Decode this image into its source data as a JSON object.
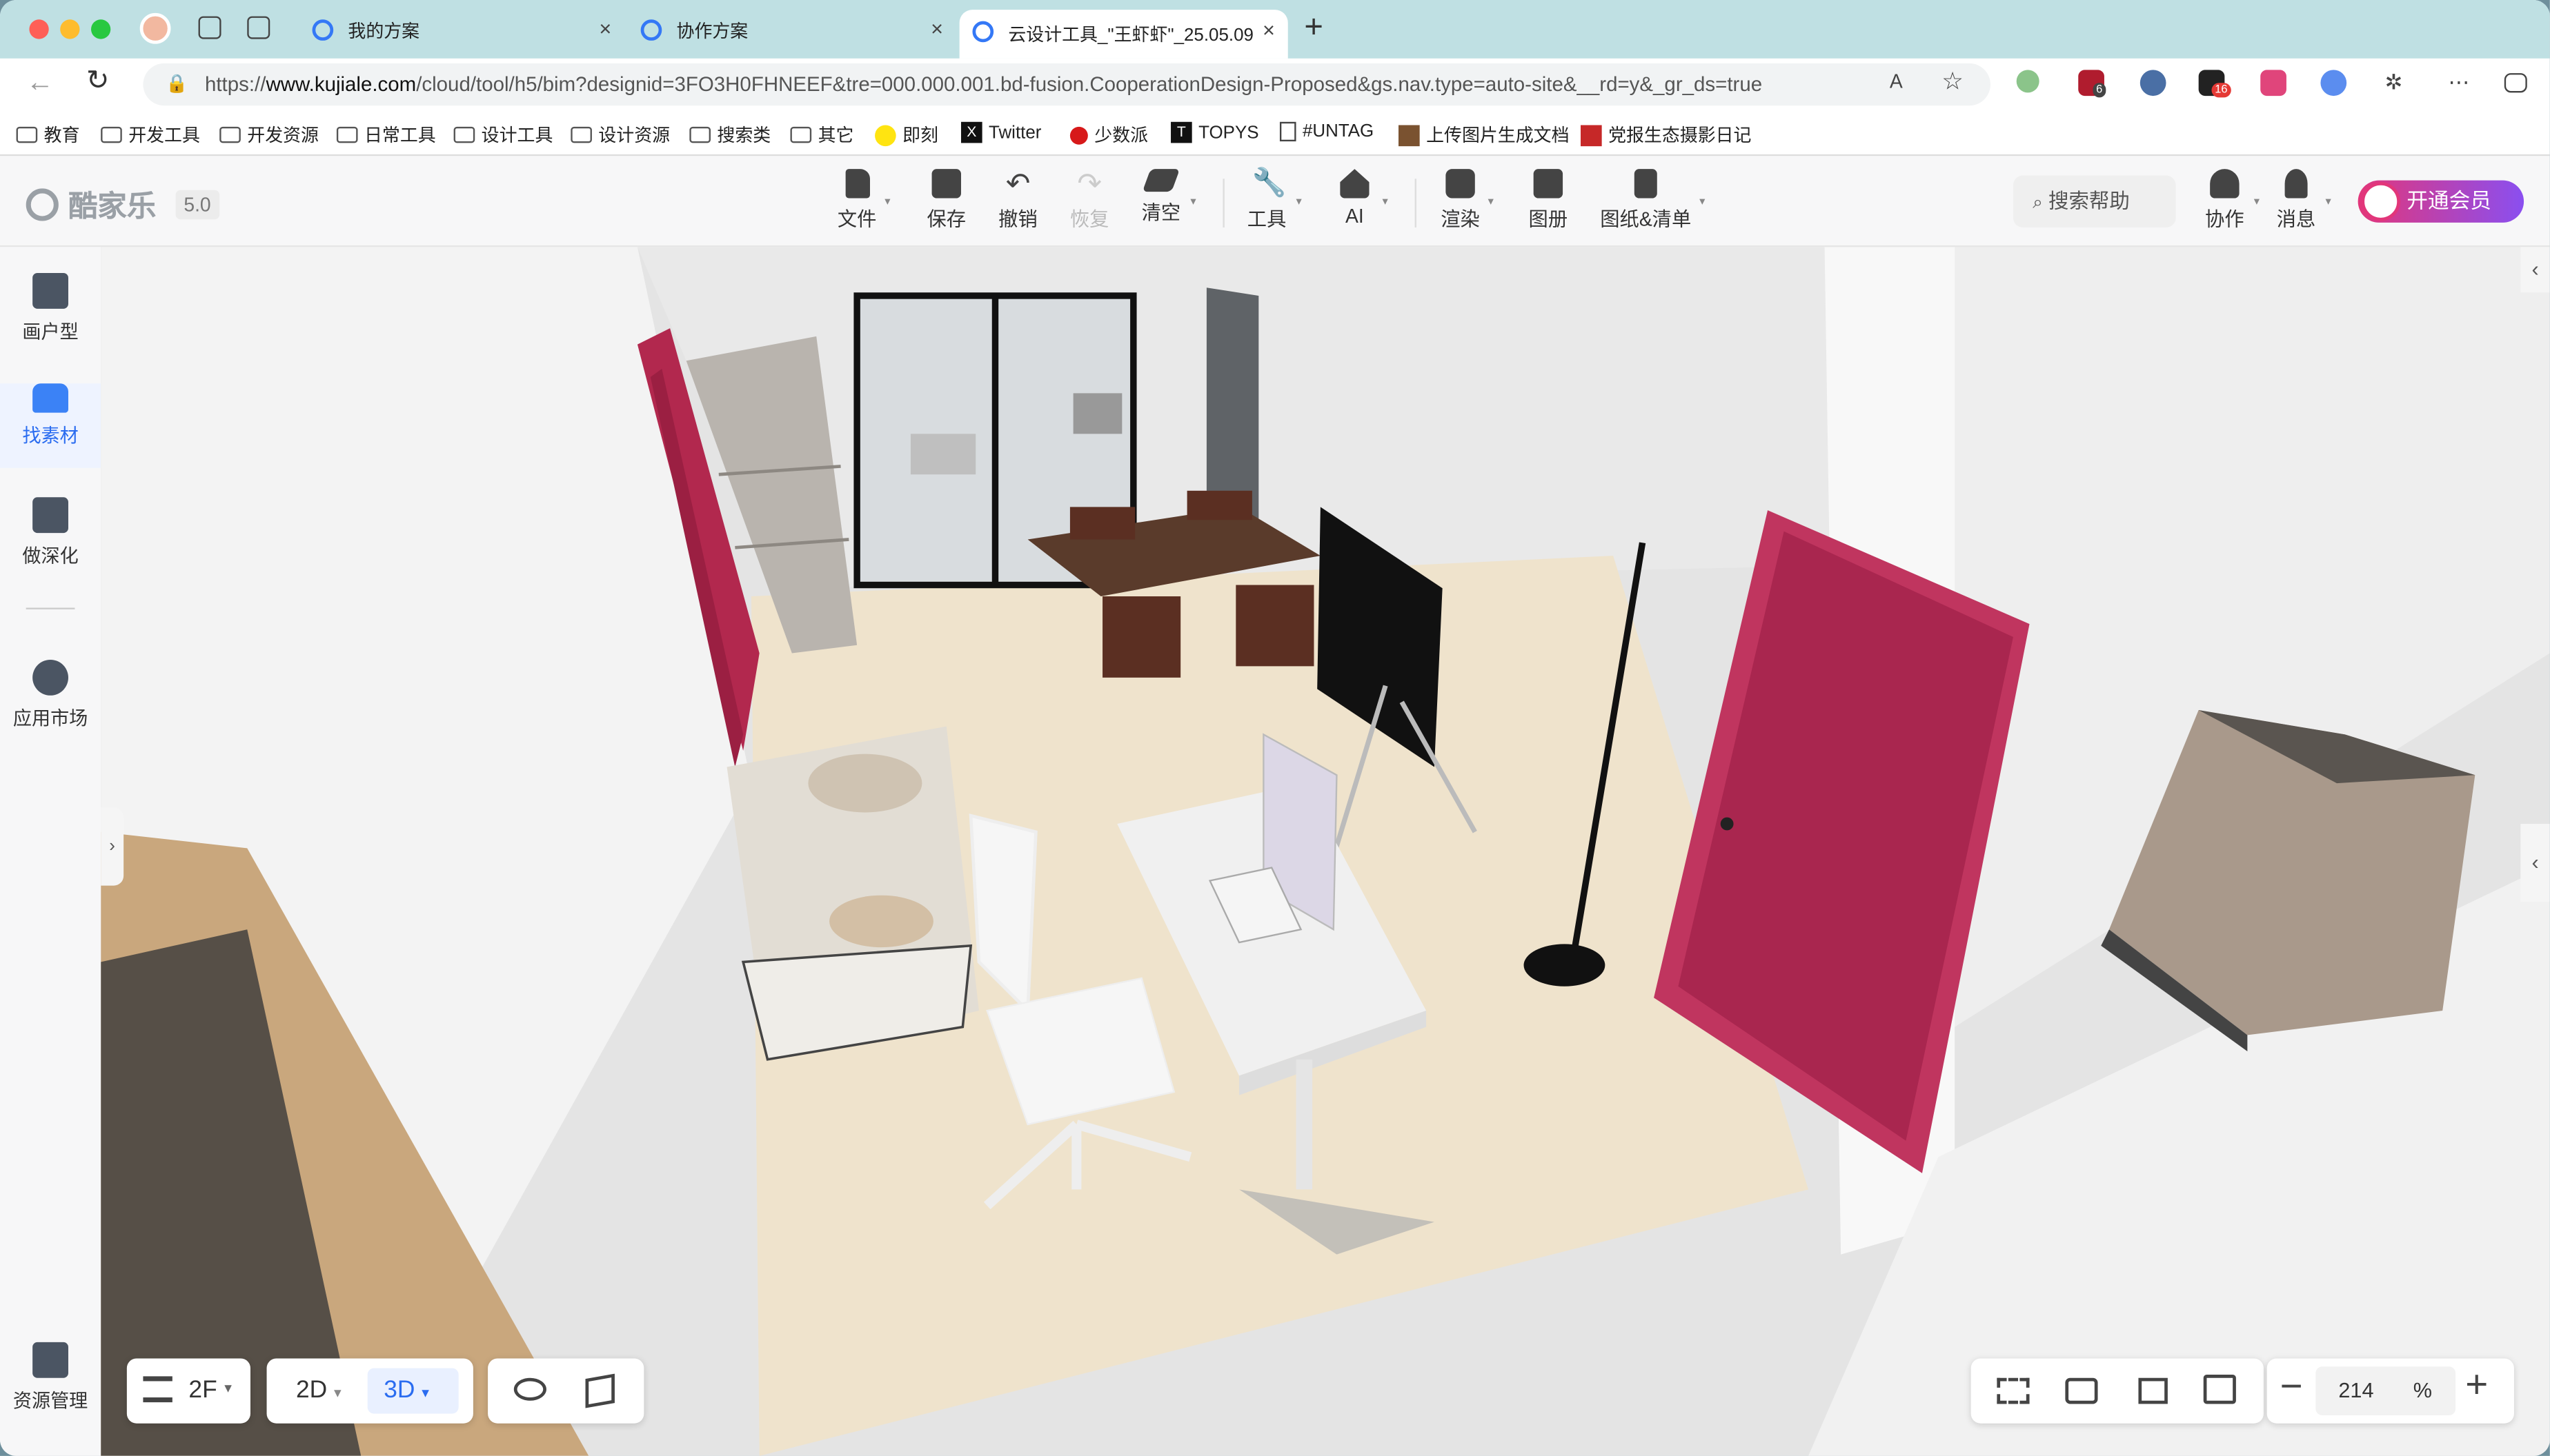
{
  "browser": {
    "tabs": [
      {
        "title": "我的方案"
      },
      {
        "title": "协作方案"
      },
      {
        "title": "云设计工具_\"王虾虾\"_25.05.09"
      }
    ],
    "url_prefix": "https://",
    "url_host": "www.kujiale.com",
    "url_path": "/cloud/tool/h5/bim?designid=3FO3H0FHNEEF&tre=000.000.001.bd-fusion.CooperationDesign-Proposed&gs.nav.type=auto-site&__rd=y&_gr_ds=true",
    "ext_badges": [
      "6",
      "16"
    ],
    "bookmarks": [
      "教育",
      "开发工具",
      "开发资源",
      "日常工具",
      "设计工具",
      "设计资源",
      "搜索类",
      "其它",
      "即刻",
      "Twitter",
      "少数派",
      "TOPYS",
      "#UNTAG",
      "上传图片生成文档",
      "党报生态摄影日记"
    ]
  },
  "app": {
    "logo": "酷家乐",
    "version": "5.0",
    "tools": [
      {
        "label": "文件",
        "icon": "file-icon"
      },
      {
        "label": "保存",
        "icon": "save-icon"
      },
      {
        "label": "撤销",
        "icon": "undo-icon"
      },
      {
        "label": "恢复",
        "icon": "redo-icon"
      },
      {
        "label": "清空",
        "icon": "eraser-icon"
      },
      {
        "label": "工具",
        "icon": "wrench-icon"
      },
      {
        "label": "AI",
        "icon": "ai-icon"
      },
      {
        "label": "渲染",
        "icon": "camera-icon"
      },
      {
        "label": "图册",
        "icon": "album-icon"
      },
      {
        "label": "图纸&清单",
        "icon": "drawing-icon"
      }
    ],
    "search_help": "搜索帮助",
    "collab": "协作",
    "messages": "消息",
    "vip": "开通会员",
    "side": [
      {
        "label": "画户型",
        "icon": "floorplan-icon"
      },
      {
        "label": "找素材",
        "icon": "sofa-icon"
      },
      {
        "label": "做深化",
        "icon": "deepen-icon"
      },
      {
        "label": "应用市场",
        "icon": "puzzle-icon"
      },
      {
        "label": "资源管理",
        "icon": "resource-icon"
      }
    ],
    "floor": "2F",
    "view_2d": "2D",
    "view_3d": "3D",
    "zoom_value": "214",
    "zoom_unit": "%"
  }
}
